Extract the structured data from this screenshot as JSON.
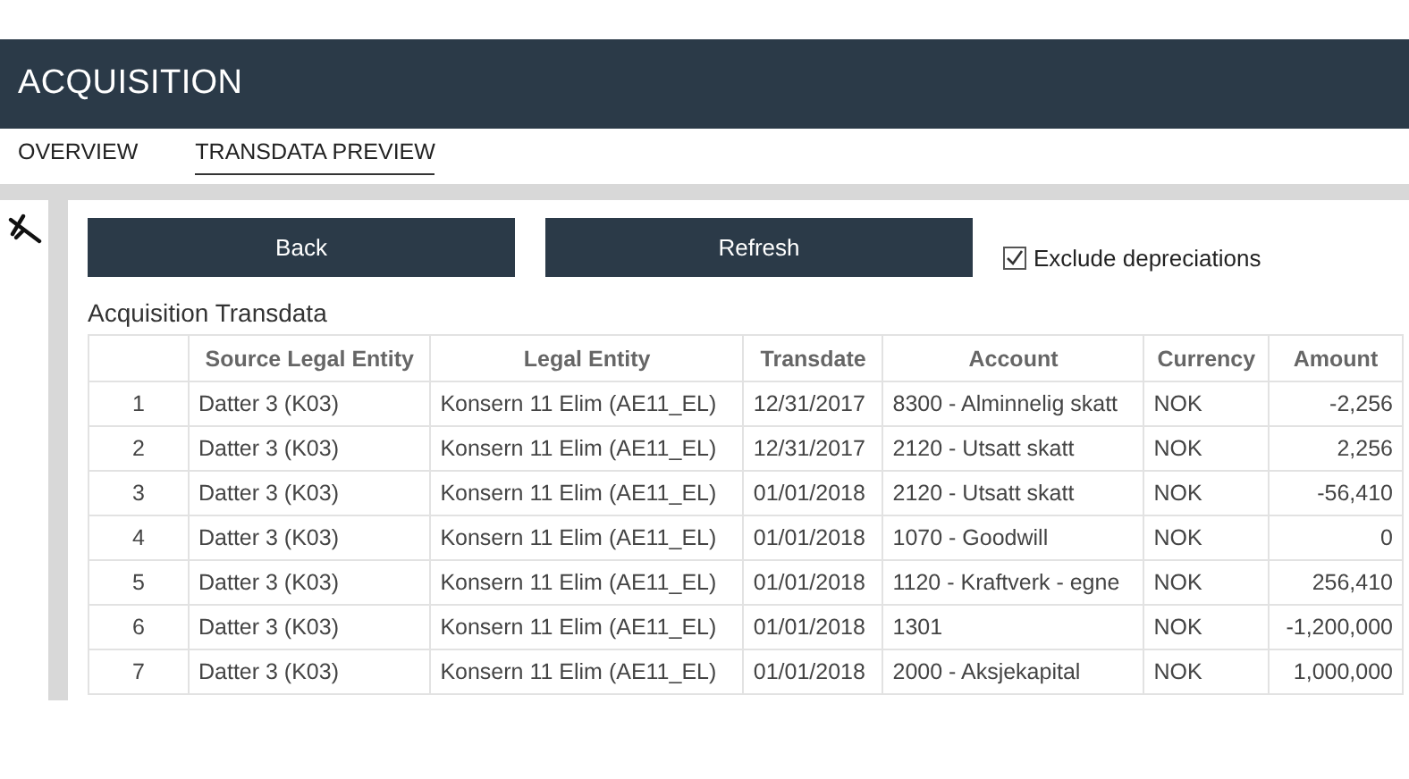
{
  "header": {
    "title": "ACQUISITION"
  },
  "tabs": [
    {
      "label": "OVERVIEW",
      "selected": false
    },
    {
      "label": "TRANSDATA PREVIEW",
      "selected": true
    }
  ],
  "toolbar": {
    "buttons": [
      "Back",
      "Refresh"
    ],
    "checkbox": {
      "label": "Exclude depreciations",
      "checked": true
    }
  },
  "section_title": "Acquisition Transdata",
  "table": {
    "columns": [
      "",
      "Source Legal Entity",
      "Legal Entity",
      "Transdate",
      "Account",
      "Currency",
      "Amount"
    ],
    "rows": [
      [
        "1",
        "Datter 3 (K03)",
        "Konsern 11 Elim (AE11_EL)",
        "12/31/2017",
        "8300 - Alminnelig skatt",
        "NOK",
        "-2,256"
      ],
      [
        "2",
        "Datter 3 (K03)",
        "Konsern 11 Elim (AE11_EL)",
        "12/31/2017",
        "2120 - Utsatt skatt",
        "NOK",
        "2,256"
      ],
      [
        "3",
        "Datter 3 (K03)",
        "Konsern 11 Elim (AE11_EL)",
        "01/01/2018",
        "2120 - Utsatt skatt",
        "NOK",
        "-56,410"
      ],
      [
        "4",
        "Datter 3 (K03)",
        "Konsern 11 Elim (AE11_EL)",
        "01/01/2018",
        "1070 - Goodwill",
        "NOK",
        "0"
      ],
      [
        "5",
        "Datter 3 (K03)",
        "Konsern 11 Elim (AE11_EL)",
        "01/01/2018",
        "1120 - Kraftverk - egne",
        "NOK",
        "256,410"
      ],
      [
        "6",
        "Datter 3 (K03)",
        "Konsern 11 Elim (AE11_EL)",
        "01/01/2018",
        "1301",
        "NOK",
        "-1,200,000"
      ],
      [
        "7",
        "Datter 3 (K03)",
        "Konsern 11 Elim (AE11_EL)",
        "01/01/2018",
        "2000 - Aksjekapital",
        "NOK",
        "1,000,000"
      ]
    ]
  }
}
